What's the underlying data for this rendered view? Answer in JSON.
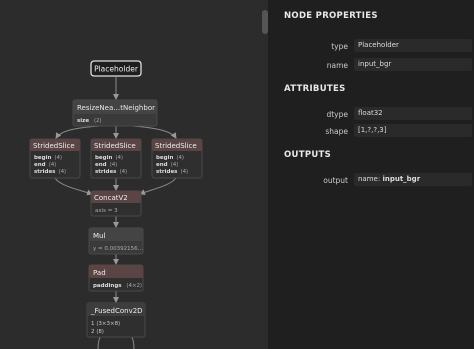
{
  "graph": {
    "nodes": {
      "placeholder": {
        "title": "Placeholder"
      },
      "resize": {
        "title": "ResizeNea…tNeighbor",
        "attr_key": "size",
        "attr_val": "⟨2⟩"
      },
      "slice1": {
        "title": "StridedSlice",
        "rows": [
          [
            "begin",
            "⟨4⟩"
          ],
          [
            "end",
            "⟨4⟩"
          ],
          [
            "strides",
            "⟨4⟩"
          ]
        ]
      },
      "slice2": {
        "title": "StridedSlice",
        "rows": [
          [
            "begin",
            "⟨4⟩"
          ],
          [
            "end",
            "⟨4⟩"
          ],
          [
            "strides",
            "⟨4⟩"
          ]
        ]
      },
      "slice3": {
        "title": "StridedSlice",
        "rows": [
          [
            "begin",
            "⟨4⟩"
          ],
          [
            "end",
            "⟨4⟩"
          ],
          [
            "strides",
            "⟨4⟩"
          ]
        ]
      },
      "concat": {
        "title": "ConcatV2",
        "attr": "axis = 3"
      },
      "mul": {
        "title": "Mul",
        "attr": "y = 0.00392156…"
      },
      "pad": {
        "title": "Pad",
        "attr_key": "paddings",
        "attr_val": "⟨4×2⟩"
      },
      "conv": {
        "title": "_FusedConv2D",
        "rows": [
          "1 ⟨3×3×8⟩",
          "2 ⟨8⟩"
        ]
      }
    }
  },
  "panel": {
    "node_properties_title": "NODE PROPERTIES",
    "type_label": "type",
    "type_value": "Placeholder",
    "name_label": "name",
    "name_value": "input_bgr",
    "attributes_title": "ATTRIBUTES",
    "dtype_label": "dtype",
    "dtype_value": "float32",
    "shape_label": "shape",
    "shape_value": "[1,?,?,3]",
    "outputs_title": "OUTPUTS",
    "output_label": "output",
    "output_name_key": "name:",
    "output_name_value": "input_bgr"
  }
}
